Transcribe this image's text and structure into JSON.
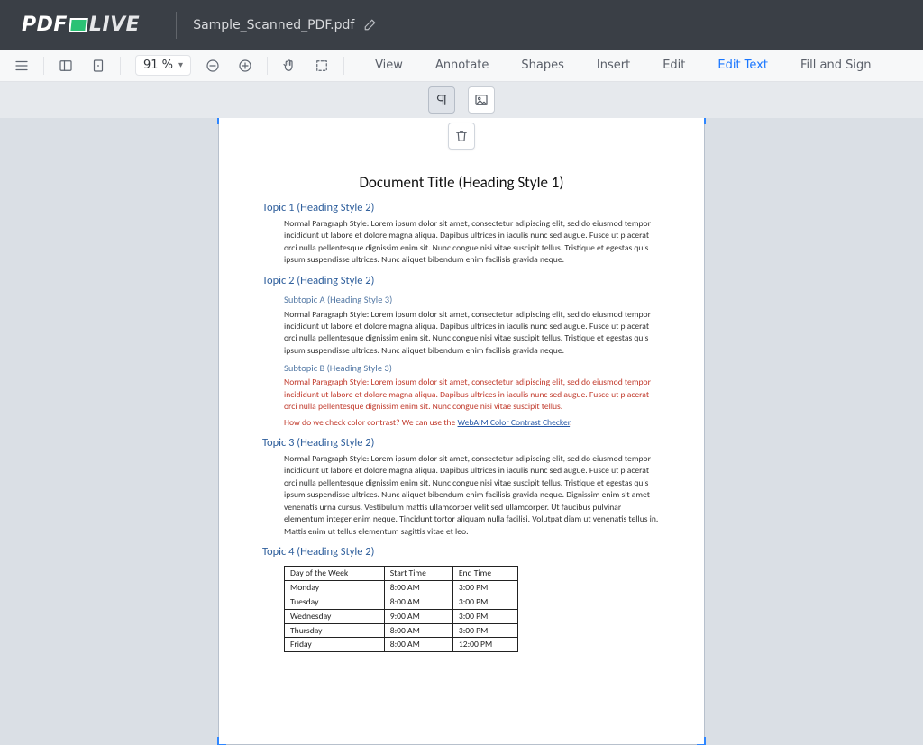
{
  "titlebar": {
    "brand_left": "PDF",
    "brand_right": "LIVE",
    "filename": "Sample_Scanned_PDF.pdf"
  },
  "toolbar": {
    "zoom_level": "91 %",
    "tabs": {
      "view": "View",
      "annotate": "Annotate",
      "shapes": "Shapes",
      "insert": "Insert",
      "edit": "Edit",
      "edit_text": "Edit Text",
      "fill_sign": "Fill and Sign"
    }
  },
  "document": {
    "title": "Document Title (Heading Style 1)",
    "topic1": {
      "heading": "Topic 1 (Heading Style 2)",
      "para": "Normal Paragraph Style: Lorem ipsum dolor sit amet, consectetur adipiscing elit, sed do eiusmod tempor incididunt ut labore et dolore magna aliqua. Dapibus ultrices in iaculis nunc sed augue. Fusce ut placerat orci nulla pellentesque dignissim enim sit. Nunc congue nisi vitae suscipit tellus. Tristique et egestas quis ipsum suspendisse ultrices. Nunc aliquet bibendum enim facilisis gravida neque."
    },
    "topic2": {
      "heading": "Topic 2 (Heading Style 2)",
      "sub_a": {
        "heading": "Subtopic A (Heading Style 3)",
        "para": "Normal Paragraph Style: Lorem ipsum dolor sit amet, consectetur adipiscing elit, sed do eiusmod tempor incididunt ut labore et dolore magna aliqua. Dapibus ultrices in iaculis nunc sed augue. Fusce ut placerat orci nulla pellentesque dignissim enim sit. Nunc congue nisi vitae suscipit tellus. Tristique et egestas quis ipsum suspendisse ultrices. Nunc aliquet bibendum enim facilisis gravida neque."
      },
      "sub_b": {
        "heading": "Subtopic B (Heading Style 3)",
        "para": "Normal Paragraph Style: Lorem ipsum dolor sit amet, consectetur adipiscing elit, sed do eiusmod tempor incididunt ut labore et dolore magna aliqua. Dapibus ultrices in iaculis nunc sed augue. Fusce ut placerat orci nulla pellentesque dignissim enim sit. Nunc congue nisi vitae suscipit tellus.",
        "contrast_pre": "How do we check color contrast?  We can use the ",
        "contrast_link": "WebAIM Color Contrast Checker",
        "contrast_post": "."
      }
    },
    "topic3": {
      "heading": "Topic 3 (Heading Style 2)",
      "para": "Normal Paragraph Style: Lorem ipsum dolor sit amet, consectetur adipiscing elit, sed do eiusmod tempor incididunt ut labore et dolore magna aliqua. Dapibus ultrices in iaculis nunc sed augue. Fusce ut placerat orci nulla pellentesque dignissim enim sit. Nunc congue nisi vitae suscipit tellus. Tristique et egestas quis ipsum suspendisse ultrices. Nunc aliquet bibendum enim facilisis gravida neque. Dignissim enim sit amet venenatis urna cursus. Vestibulum mattis ullamcorper velit sed ullamcorper. Ut faucibus pulvinar elementum integer enim neque. Tincidunt tortor aliquam nulla facilisi. Volutpat diam ut venenatis tellus in. Mattis enim ut tellus elementum sagittis vitae et leo."
    },
    "topic4": {
      "heading": "Topic 4 (Heading Style 2)",
      "table": {
        "headers": {
          "c1": "Day of the Week",
          "c2": "Start Time",
          "c3": "End Time"
        },
        "rows": [
          {
            "c1": "Monday",
            "c2": "8:00 AM",
            "c3": "3:00 PM"
          },
          {
            "c1": "Tuesday",
            "c2": "8:00 AM",
            "c3": "3:00 PM"
          },
          {
            "c1": "Wednesday",
            "c2": "9:00 AM",
            "c3": "3:00 PM"
          },
          {
            "c1": "Thursday",
            "c2": "8:00 AM",
            "c3": "3:00 PM"
          },
          {
            "c1": "Friday",
            "c2": "8:00 AM",
            "c3": "12:00 PM"
          }
        ]
      }
    }
  }
}
